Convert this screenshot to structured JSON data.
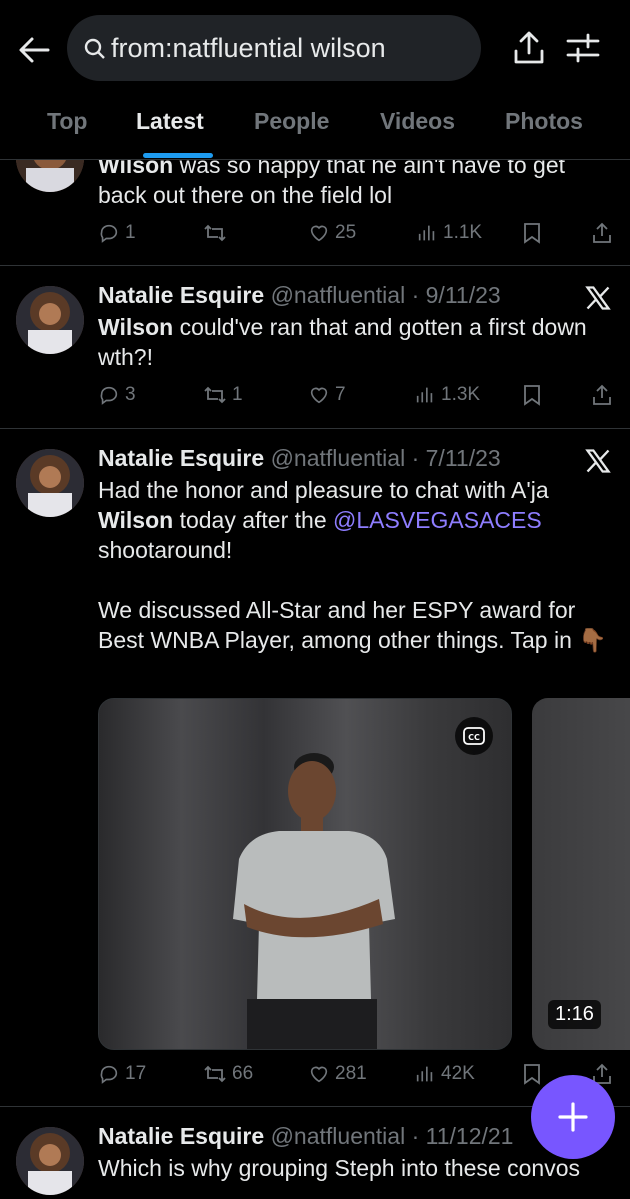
{
  "search": {
    "query": "from:natfluential wilson"
  },
  "tabs": [
    "Top",
    "Latest",
    "People",
    "Videos",
    "Photos"
  ],
  "active_tab": "Latest",
  "posts": [
    {
      "text_bold": "Wilson",
      "text_rest": " was so happy that he ain't have to get back out there on the field lol",
      "replies": "1",
      "reposts": "",
      "likes": "25",
      "views": "1.1K"
    },
    {
      "name": "Natalie Esquire",
      "handle": "@natfluential",
      "date": "9/11/23",
      "text_bold": "Wilson",
      "text_rest": " could've ran that and gotten a first down wth?!",
      "replies": "3",
      "reposts": "1",
      "likes": "7",
      "views": "1.3K"
    },
    {
      "name": "Natalie Esquire",
      "handle": "@natfluential",
      "date": "7/11/23",
      "text_1": "Had the honor and pleasure to chat with A'ja ",
      "text_bold": "Wilson",
      "text_2": " today after the ",
      "mention": "@LASVEGASACES",
      "text_3": " shootaround!",
      "text_para2": "We discussed All-Star and her ESPY award for Best WNBA Player, among other things. Tap in 👇🏾",
      "video_duration": "1:16",
      "replies": "17",
      "reposts": "66",
      "likes": "281",
      "views": "42K"
    },
    {
      "name": "Natalie Esquire",
      "handle": "@natfluential",
      "date": "11/12/21",
      "text": "Which is why grouping Steph into these convos"
    }
  ],
  "icons": {
    "back": "arrow-left-icon",
    "search": "magnifier-icon",
    "share": "share-icon",
    "filter": "sliders-icon",
    "x_logo": "x-logo-icon",
    "compose": "plus-icon",
    "cc": "closed-captions-icon"
  },
  "colors": {
    "accent": "#1d9bf0",
    "mention": "#8e7dff",
    "fab": "#7856ff",
    "muted": "#71767b"
  }
}
